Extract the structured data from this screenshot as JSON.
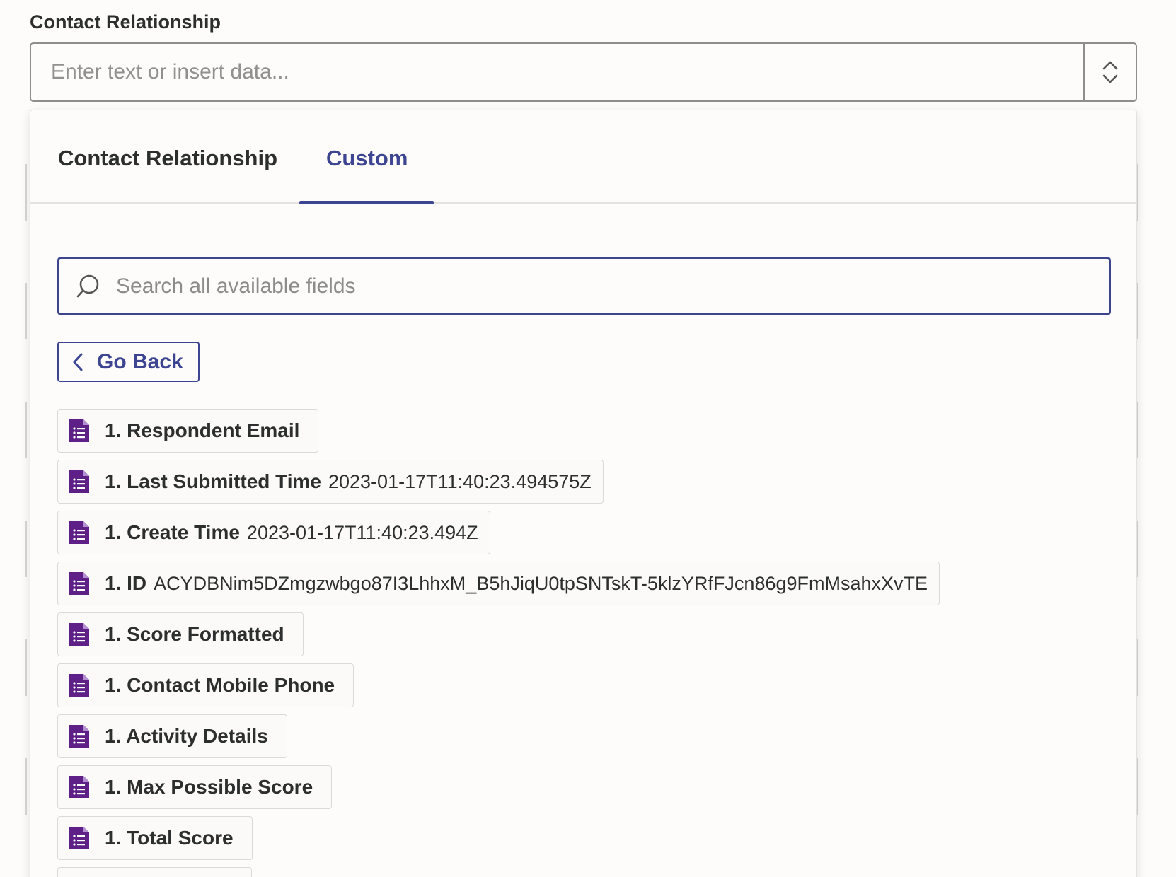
{
  "field": {
    "label": "Contact Relationship",
    "placeholder": "Enter text or insert data..."
  },
  "tabs": [
    {
      "label": "Contact Relationship",
      "active": false
    },
    {
      "label": "Custom",
      "active": true
    }
  ],
  "search": {
    "placeholder": "Search all available fields"
  },
  "go_back": {
    "label": "Go Back"
  },
  "colors": {
    "accent": "#3d4592",
    "forms_icon": "#5e1f87"
  },
  "items": [
    {
      "name": "1. Respondent Email",
      "value": ""
    },
    {
      "name": "1. Last Submitted Time",
      "value": "2023-01-17T11:40:23.494575Z"
    },
    {
      "name": "1. Create Time",
      "value": "2023-01-17T11:40:23.494Z"
    },
    {
      "name": "1. ID",
      "value": "ACYDBNim5DZmgzwbgo87I3LhhxM_B5hJiqU0tpSNTskT-5klzYRfFJcn86g9FmMsahxXvTE"
    },
    {
      "name": "1. Score Formatted",
      "value": ""
    },
    {
      "name": "1. Contact Mobile Phone",
      "value": ""
    },
    {
      "name": "1. Activity Details",
      "value": ""
    },
    {
      "name": "1. Max Possible Score",
      "value": ""
    },
    {
      "name": "1. Total Score",
      "value": ""
    }
  ]
}
